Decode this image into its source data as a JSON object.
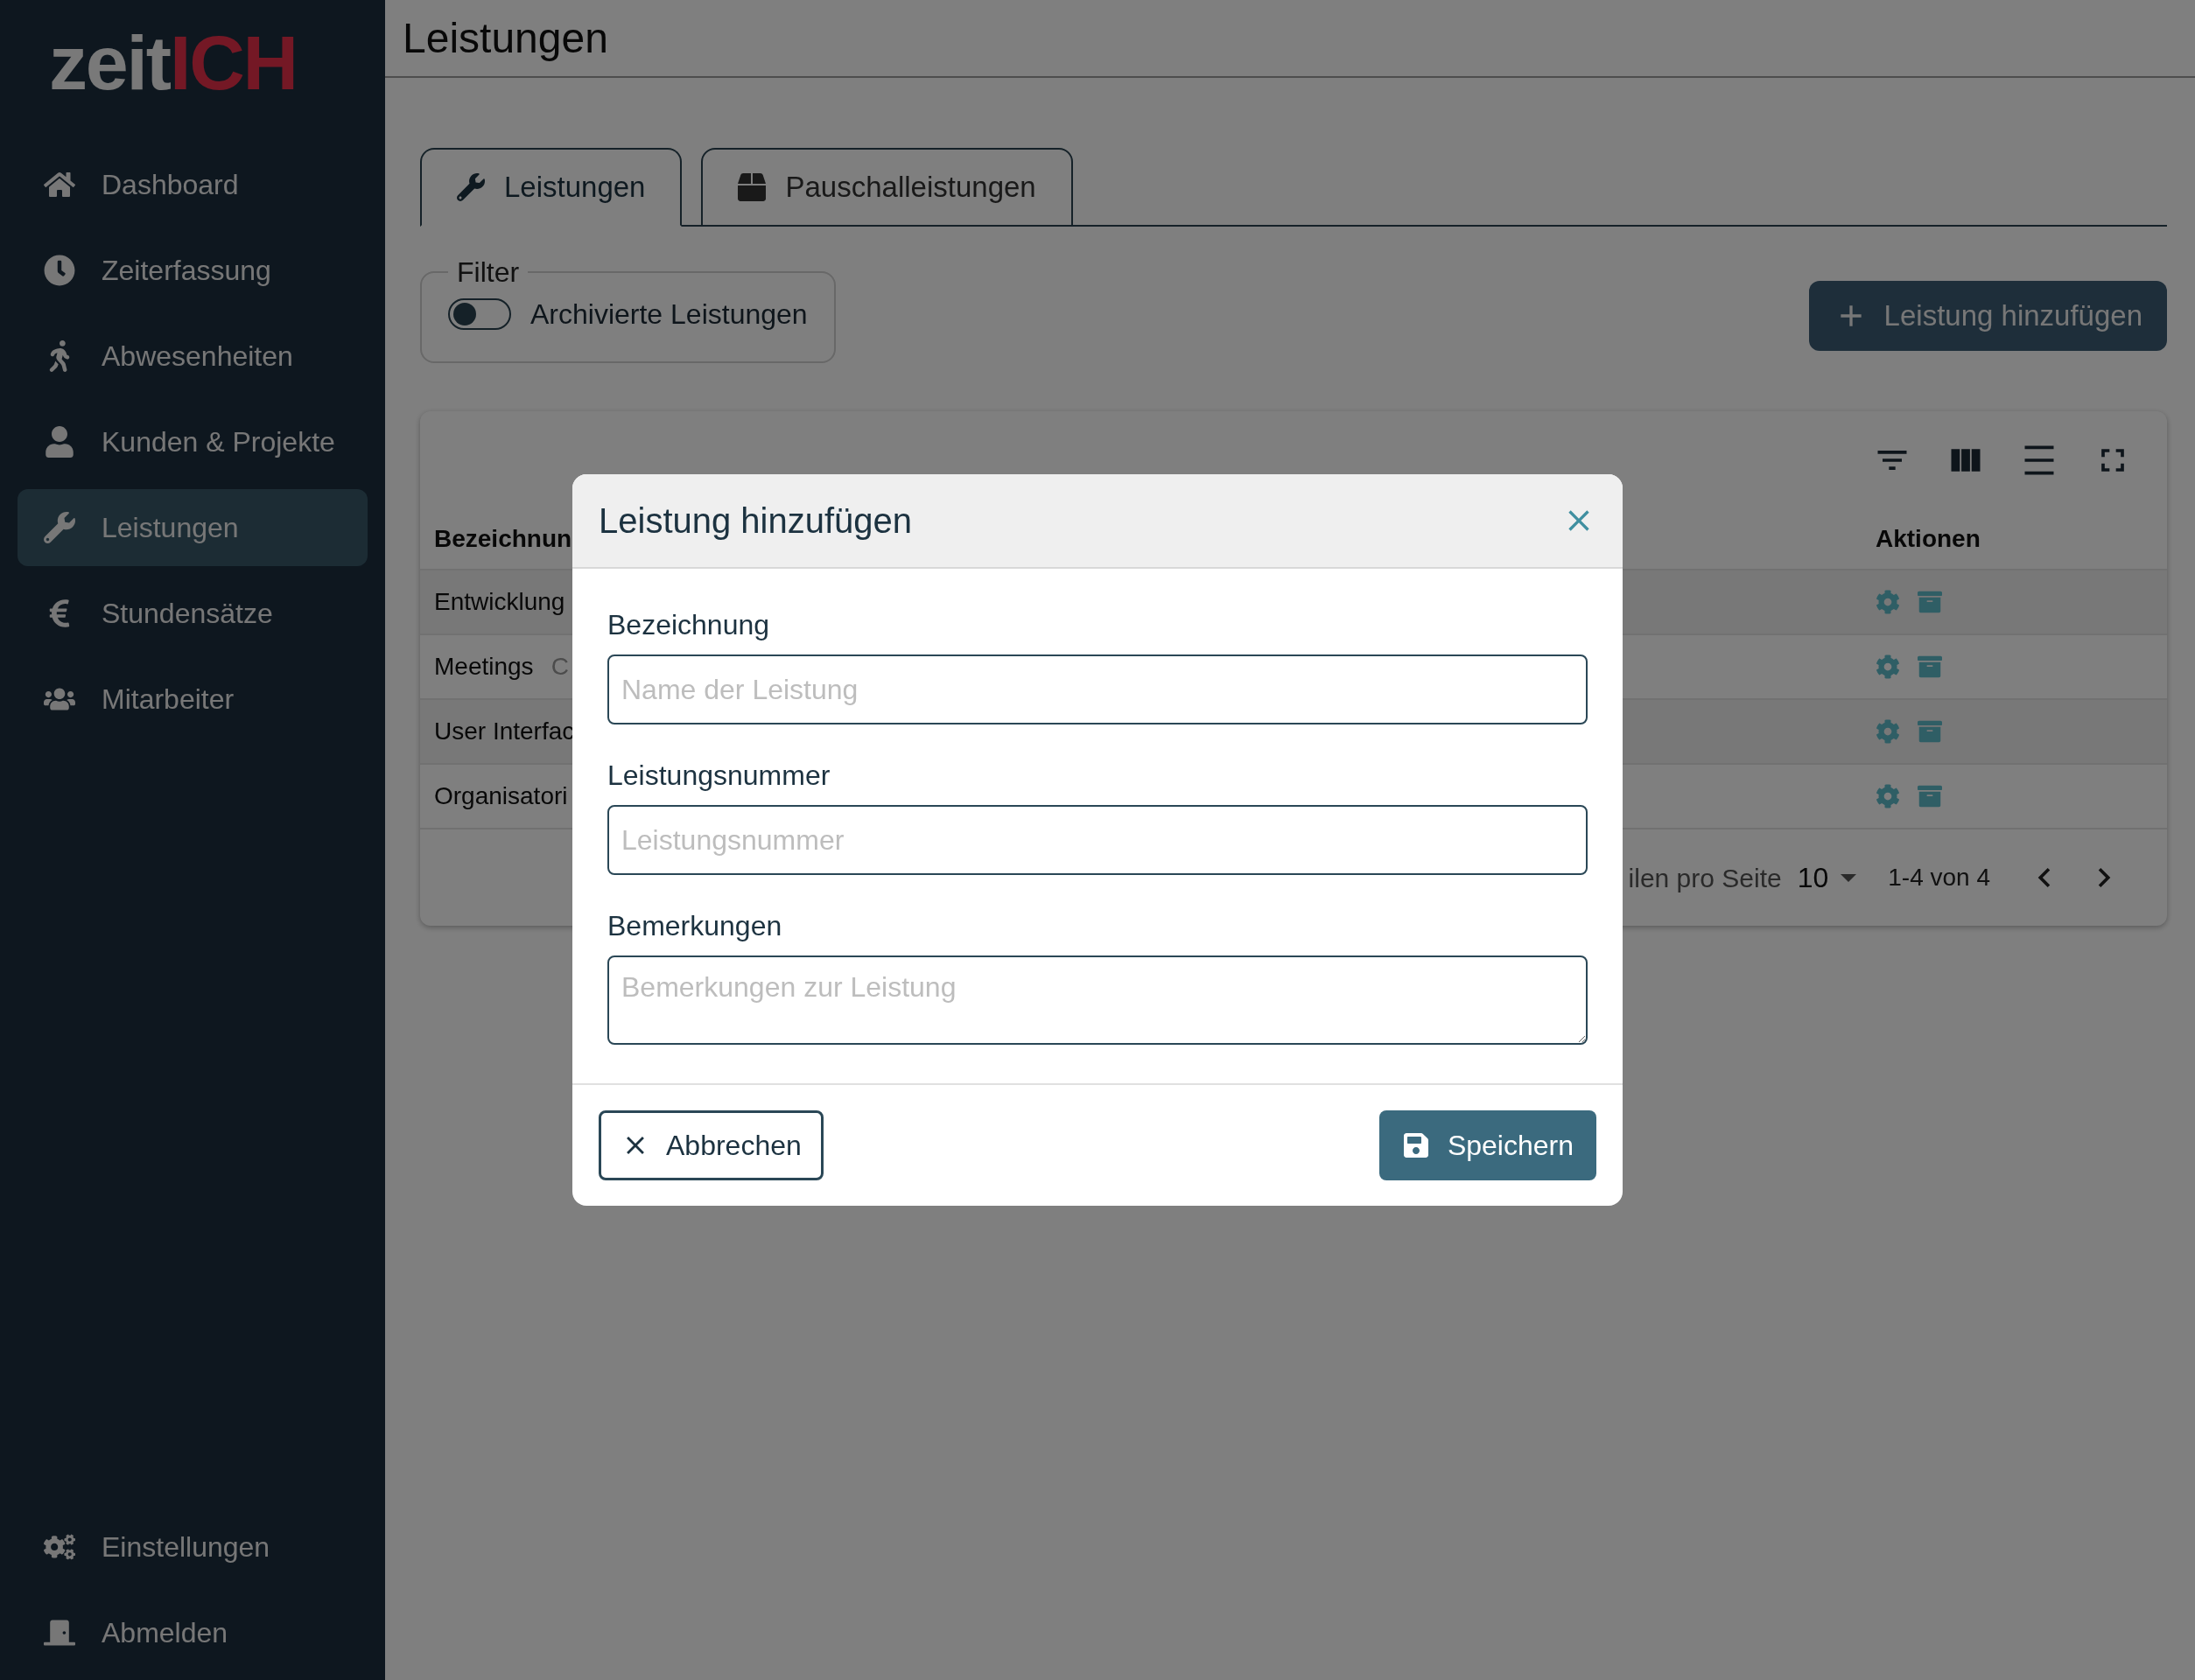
{
  "logo": {
    "part_1": "zeit",
    "part_2": "ICH"
  },
  "sidebar": {
    "items": [
      {
        "label": "Dashboard",
        "selected": false
      },
      {
        "label": "Zeiterfassung",
        "selected": false
      },
      {
        "label": "Abwesenheiten",
        "selected": false
      },
      {
        "label": "Kunden & Projekte",
        "selected": false
      },
      {
        "label": "Leistungen",
        "selected": true
      },
      {
        "label": "Stundensätze",
        "selected": false
      },
      {
        "label": "Mitarbeiter",
        "selected": false
      }
    ],
    "bottom_items": [
      {
        "label": "Einstellungen"
      },
      {
        "label": "Abmelden"
      }
    ]
  },
  "page_title": "Leistungen",
  "tabs": [
    {
      "label": "Leistungen",
      "selected": true
    },
    {
      "label": "Pauschalleistungen",
      "selected": false
    }
  ],
  "filter": {
    "legend": "Filter",
    "toggle": {
      "label": "Archivierte Leistungen",
      "on": false
    }
  },
  "add_button": "Leistung hinzufügen",
  "table": {
    "columns": [
      "Bezeichnun",
      "Aktionen"
    ],
    "rows": [
      {
        "name": "Entwicklung"
      },
      {
        "name": "Meetings",
        "detail": "C"
      },
      {
        "name": "User Interfac"
      },
      {
        "name": "Organisatori"
      }
    ],
    "footer": {
      "rows_per_page_label": "ilen pro Seite",
      "rows_per_page": "10",
      "range": "1-4 von 4"
    }
  },
  "dialog": {
    "title": "Leistung hinzufügen",
    "fields": [
      {
        "label": "Bezeichnung",
        "placeholder": "Name der Leistung",
        "kind": "input"
      },
      {
        "label": "Leistungsnummer",
        "placeholder": "Leistungsnummer",
        "kind": "input"
      },
      {
        "label": "Bemerkungen",
        "placeholder": "Bemerkungen zur Leistung",
        "kind": "textarea"
      }
    ],
    "cancel": "Abbrechen",
    "save": "Speichern"
  }
}
